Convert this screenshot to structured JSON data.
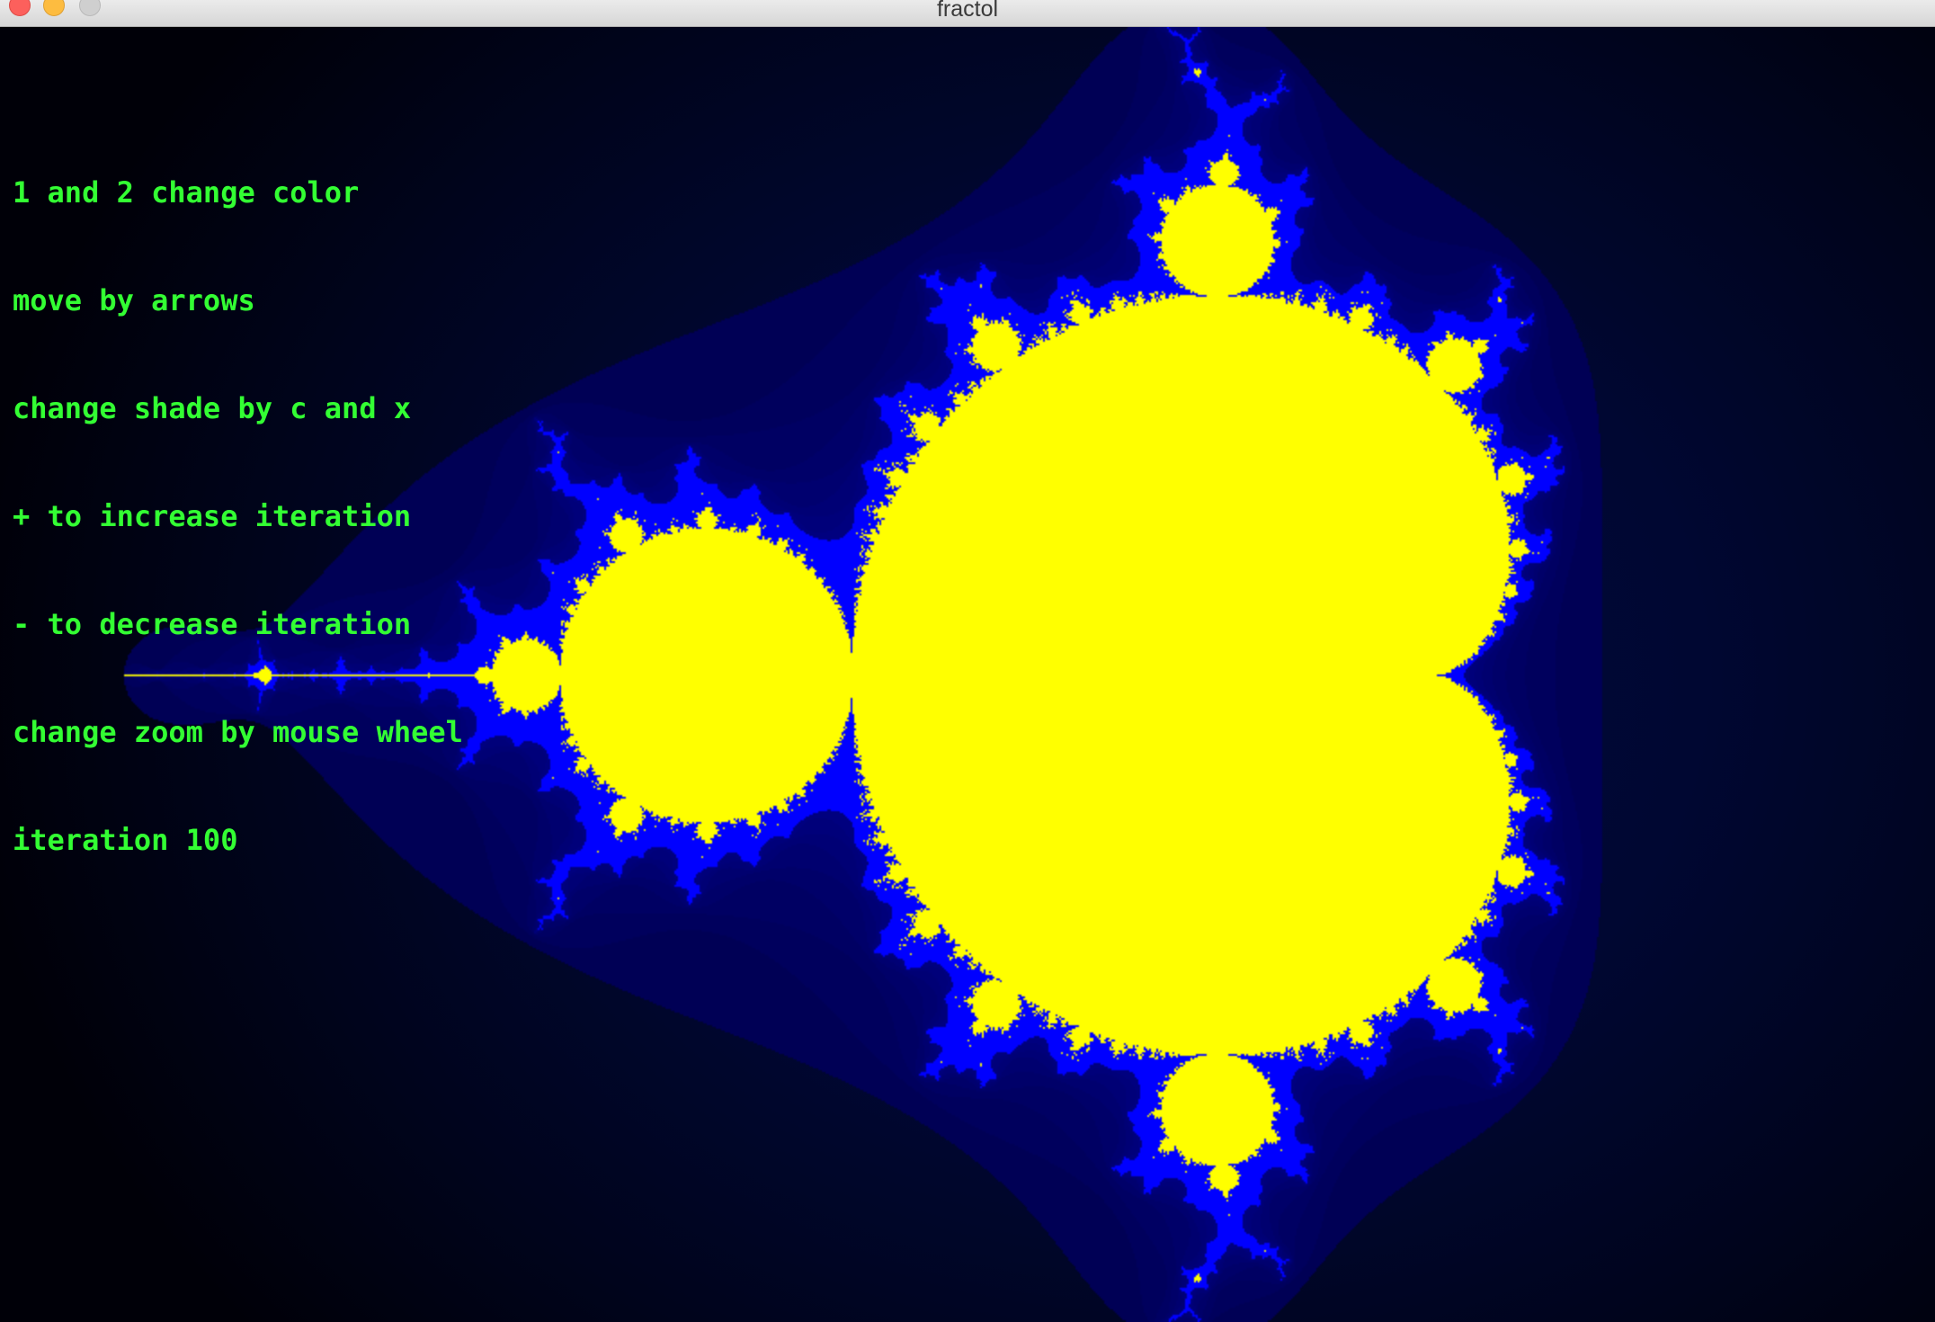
{
  "window": {
    "title": "fractol"
  },
  "help_text": {
    "lines": [
      "1 and 2 change color",
      "move by arrows",
      "change shade by c and x",
      "+ to increase iteration",
      "- to decrease iteration",
      "change zoom by mouse wheel"
    ],
    "iteration_label": "iteration",
    "iteration_value": "100"
  },
  "fractal": {
    "type": "mandelbrot",
    "max_iteration": 100,
    "set_color": "#ffff00",
    "edge_color": "#0000ff",
    "background_color": "#000000"
  },
  "colors": {
    "text": "#33ff33",
    "close_button": "#fc605c",
    "minimize_button": "#fdbc40",
    "maximize_button": "#cfcfcf"
  }
}
